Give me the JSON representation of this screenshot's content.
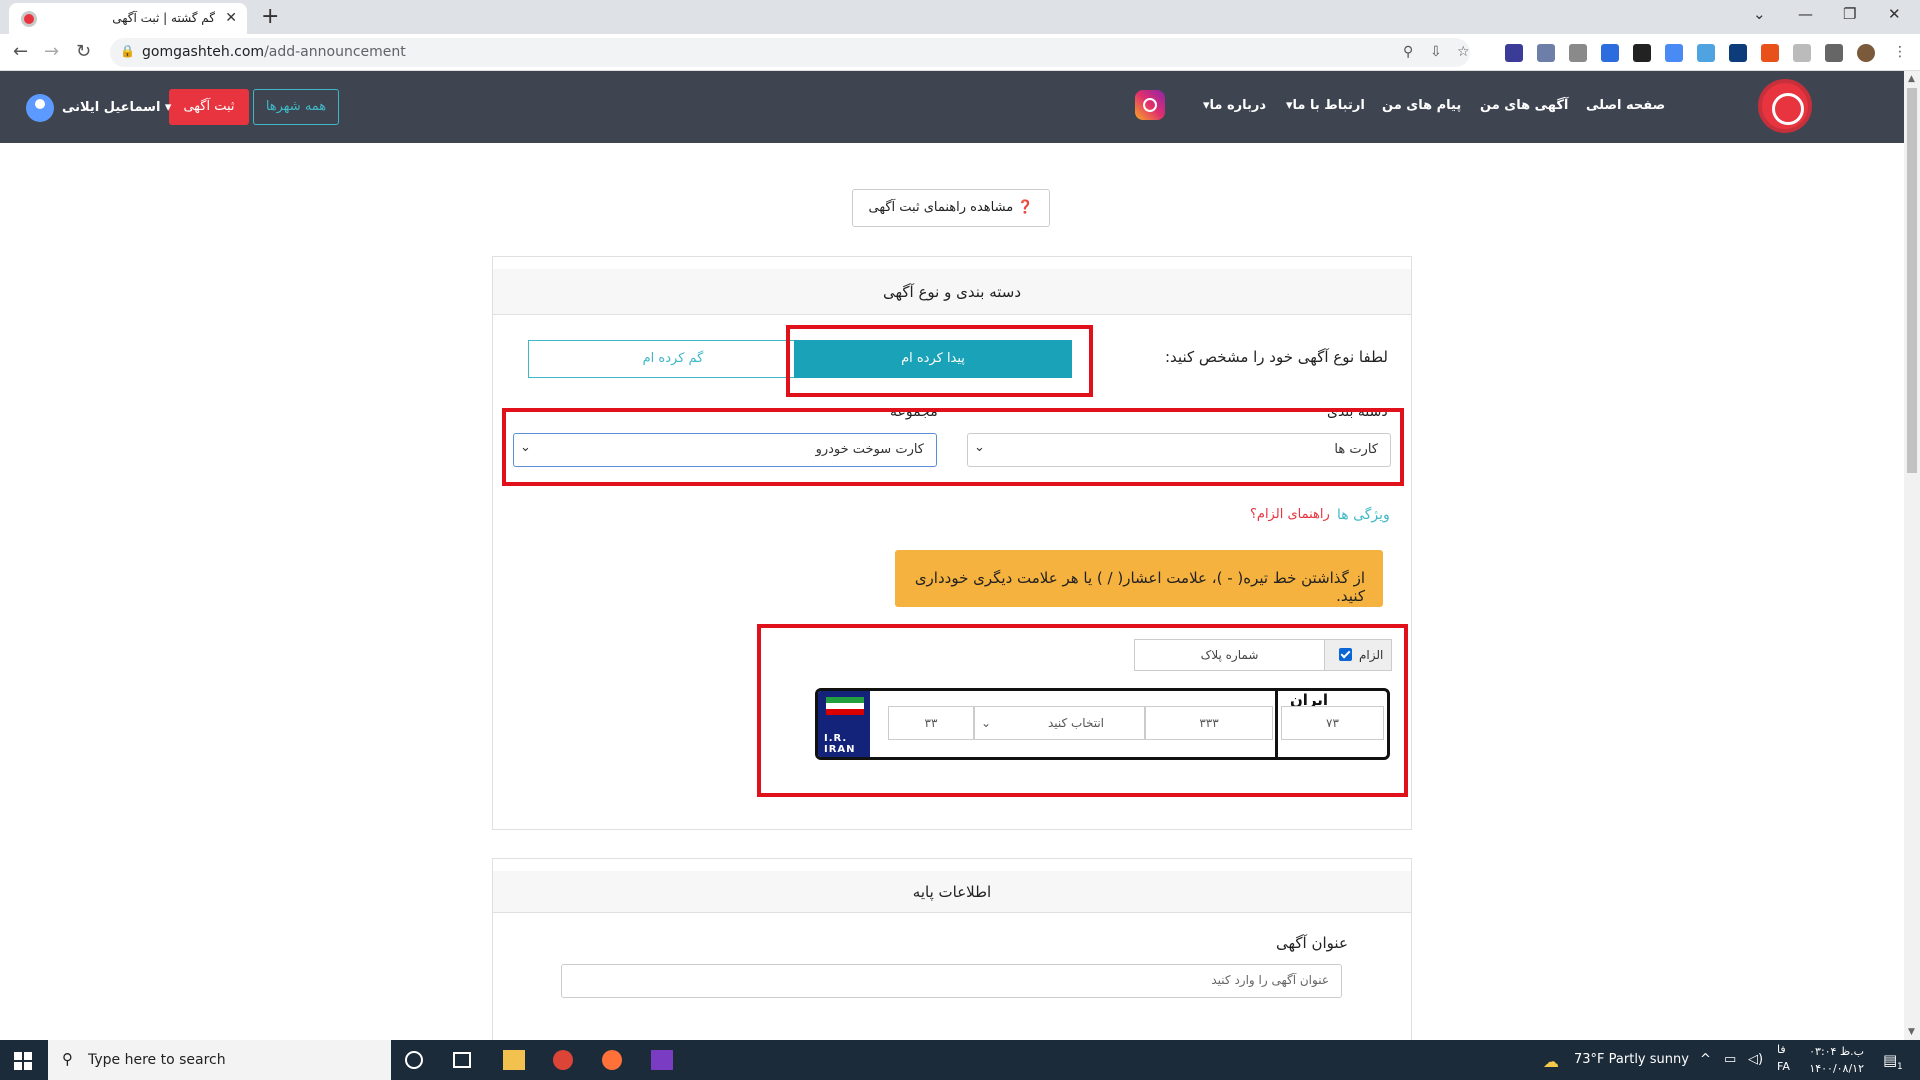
{
  "browser": {
    "tab_title": "گم گشته | ثبت آگهی",
    "url_host": "gomgashteh.com",
    "url_path": "/add-announcement"
  },
  "nav": {
    "home": "صفحه اصلی",
    "my_ads": "آگهی های من",
    "my_messages": "پیام های من",
    "contact": "ارتباط با ما",
    "about": "درباره ما",
    "all_cities": "همه شهرها",
    "post_ad": "ثبت آگهی",
    "user_name": "اسماعیل ایلانی"
  },
  "content": {
    "guide_button": "مشاهده راهنمای ثبت آگهی",
    "category_card_title": "دسته بندی و نوع آگهی",
    "type_prompt": "لطفا نوع آگهی خود را مشخص کنید:",
    "found_label": "پیدا کرده ام",
    "lost_label": "گم کرده ام",
    "category_label": "دسته بندی",
    "category_value": "کارت ها",
    "subcategory_label": "مجموعه",
    "subcategory_value": "کارت سوخت خودرو",
    "features_link": "ویژگی ها",
    "required_guide_link": "راهنمای الزام؟",
    "warning_text": "از گذاشتن خط تیره( - )، علامت اعشار( / ) یا هر علامت دیگری خودداری کنید.",
    "required_checkbox_label": "الزام",
    "required_checked": true,
    "plate_number_label": "شماره پلاک",
    "plate": {
      "iran_latin": "I.R. IRAN",
      "iran_persian": "ایران",
      "region_code": "۷۳",
      "three_digits": "۳۳۳",
      "letter_select": "انتخاب کنید",
      "two_digits": "۳۳"
    },
    "basic_info_title": "اطلاعات پایه",
    "ad_title_label": "عنوان آگهی",
    "ad_title_placeholder": "عنوان آگهی را وارد کنید"
  },
  "taskbar": {
    "search_placeholder": "Type here to search",
    "weather": "73°F  Partly sunny",
    "lang": "فا",
    "lang_code": "FA",
    "time": "ب.ظ ۰۳:۰۴",
    "date": "۱۴۰۰/۰۸/۱۲",
    "notification_count": "1"
  },
  "colors": {
    "nav_bg": "#3e4551",
    "brand_red": "#e8343f",
    "teal": "#1aa2b8",
    "warning": "#f6b23e",
    "highlight_red": "#e0111a"
  }
}
